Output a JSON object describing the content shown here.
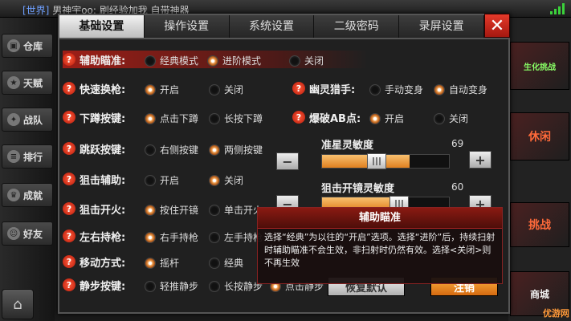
{
  "chat": {
    "channel": "[世界]",
    "text": "男神宇oo: 刷经验加我 自带神器"
  },
  "nav": [
    {
      "label": "仓库",
      "icon": "warehouse-icon"
    },
    {
      "label": "天赋",
      "icon": "talent-icon"
    },
    {
      "label": "战队",
      "icon": "team-icon"
    },
    {
      "label": "排行",
      "icon": "rank-icon"
    },
    {
      "label": "成就",
      "icon": "achievement-icon"
    },
    {
      "label": "好友",
      "icon": "friends-icon"
    }
  ],
  "right_panel": [
    "生化挑战",
    "休闲",
    "挑战",
    "商城"
  ],
  "tabs": [
    "基础设置",
    "操作设置",
    "系统设置",
    "二级密码",
    "录屏设置"
  ],
  "settings": {
    "aim_assist": {
      "label": "辅助瞄准:",
      "opt1": "经典模式",
      "opt2": "进阶模式",
      "opt3": "关闭"
    },
    "quick_switch": {
      "label": "快速换枪:",
      "on": "开启",
      "off": "关闭"
    },
    "ghost_hunter": {
      "label": "幽灵猎手:",
      "opt1": "手动变身",
      "opt2": "自动变身"
    },
    "crouch": {
      "label": "下蹲按键:",
      "opt1": "点击下蹲",
      "opt2": "长按下蹲"
    },
    "blast_ab": {
      "label": "爆破AB点:",
      "on": "开启",
      "off": "关闭"
    },
    "jump": {
      "label": "跳跃按键:",
      "opt1": "右侧按键",
      "opt2": "两侧按键"
    },
    "sniper_assist": {
      "label": "狙击辅助:",
      "on": "开启",
      "off": "关闭"
    },
    "sniper_fire": {
      "label": "狙击开火:",
      "opt1": "按住开镜",
      "opt2": "单击开火"
    },
    "hand": {
      "label": "左右持枪:",
      "opt1": "右手持枪",
      "opt2": "左手持枪"
    },
    "move": {
      "label": "移动方式:",
      "opt1": "摇杆",
      "opt2": "经典"
    },
    "silent": {
      "label": "静步按键:",
      "opt1": "轻推静步",
      "opt2": "长按静步",
      "opt3": "点击静步"
    }
  },
  "sliders": {
    "sensitivity": {
      "title": "准星灵敏度",
      "value": "69"
    },
    "scope_sensitivity": {
      "title": "狙击开镜灵敏度",
      "value": "60"
    }
  },
  "buttons": {
    "reset": "恢复默认",
    "logout": "注销"
  },
  "tooltip": {
    "title": "辅助瞄准",
    "body": "选择“经典”为以往的“开启”选项。选择“进阶”后，持续扫射时辅助瞄准不会生效，非扫射时仍然有效。选择<关闭>则不再生效"
  },
  "watermark": "优游网",
  "colors": {
    "accent": "#c8201a",
    "radio_on": "#f0a050",
    "slider_fill": "#e08020"
  }
}
